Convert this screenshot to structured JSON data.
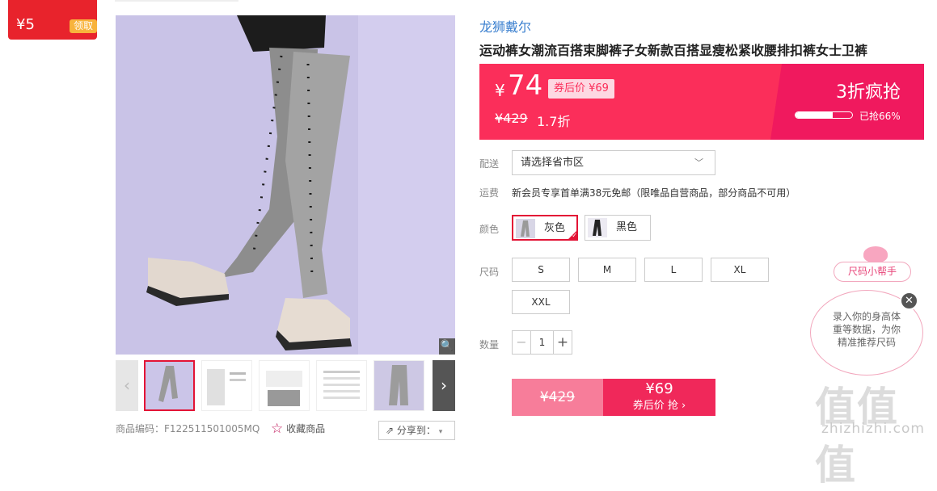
{
  "coupon": {
    "amount": "¥5",
    "action": "领取"
  },
  "product": {
    "brand": "龙狮戴尔",
    "title": "运动裤女潮流百搭束脚裤子女新款百搭显瘦松紧收腰排扣裤女士卫裤",
    "code_label": "商品编码：F122511501005MQ",
    "favorite": "收藏商品",
    "share": "分享到："
  },
  "price": {
    "currency": "¥",
    "current": "74",
    "after_coupon": "券后价 ¥69",
    "original": "¥429",
    "discount": "1.7折",
    "promo_title": "3折疯抢",
    "sold_label": "已抢66%",
    "sold_fraction": 0.66
  },
  "delivery": {
    "label": "配送",
    "placeholder": "请选择省市区"
  },
  "shipping": {
    "label": "运费",
    "text": "新会员专享首单满38元免邮（限唯品自营商品，部分商品不可用）"
  },
  "colors": {
    "label": "颜色",
    "options": [
      "灰色",
      "黑色"
    ],
    "selected": "灰色"
  },
  "sizes": {
    "label": "尺码",
    "options": [
      "S",
      "M",
      "L",
      "XL",
      "XXL"
    ]
  },
  "quantity": {
    "label": "数量",
    "value": "1",
    "minus": "−",
    "plus": "+"
  },
  "buy": {
    "original": "¥429",
    "price": "¥69",
    "action": "券后价 抢 ›"
  },
  "helper": {
    "button": "尺码小帮手",
    "text": "录入你的身高体重等数据，为你精准推荐尺码",
    "close": "✕"
  },
  "watermark": {
    "big": "值值值",
    "small": "zhizhizhi.com"
  },
  "icons": {
    "zoom": "🔍",
    "star": "☆",
    "share": "⇗",
    "prev": "‹",
    "next": "›"
  },
  "theme": {
    "accent": "#fb2e5a",
    "coupon": "#e8232c",
    "brand_link": "#3a7fcf"
  }
}
